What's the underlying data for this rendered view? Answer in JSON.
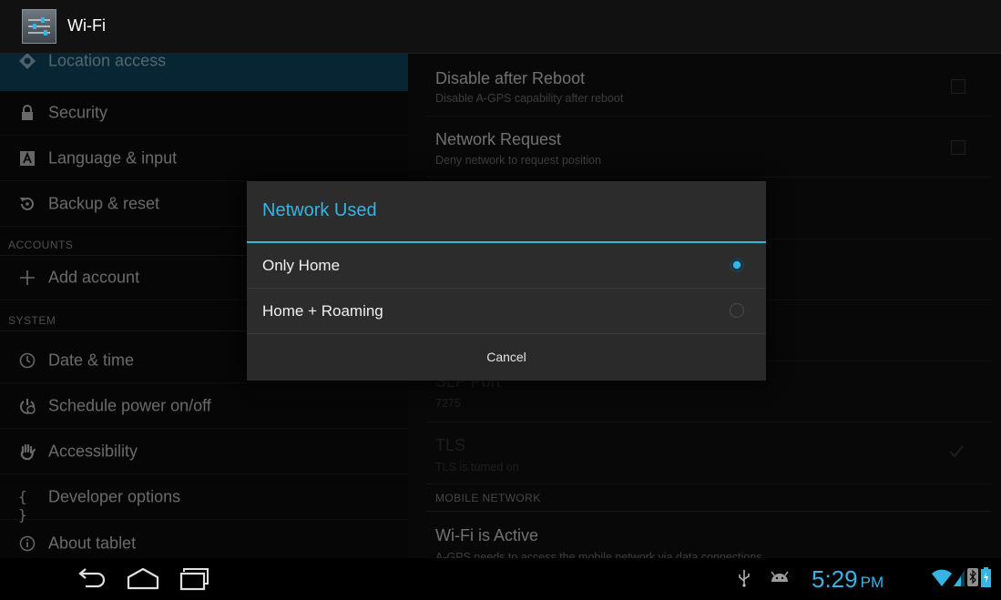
{
  "action_bar": {
    "title": "Wi-Fi",
    "icon": "settings-sliders-icon"
  },
  "left_menu": {
    "items_top": [
      {
        "label": "Location access",
        "icon": "location-icon",
        "active": true
      },
      {
        "label": "Security",
        "icon": "lock-icon"
      },
      {
        "label": "Language & input",
        "icon": "keyboard-icon"
      },
      {
        "label": "Backup & reset",
        "icon": "backup-icon"
      }
    ],
    "accounts_header": "ACCOUNTS",
    "add_account": {
      "label": "Add account",
      "icon": "plus-icon"
    },
    "system_header": "SYSTEM",
    "items_system": [
      {
        "label": "Date & time",
        "icon": "clock-icon"
      },
      {
        "label": "Schedule power on/off",
        "icon": "power-schedule-icon"
      },
      {
        "label": "Accessibility",
        "icon": "hand-icon"
      },
      {
        "label": "Developer options",
        "icon": "braces-icon"
      },
      {
        "label": "About tablet",
        "icon": "info-icon"
      }
    ]
  },
  "right_pane": {
    "prefs": [
      {
        "title": "Disable after Reboot",
        "summary": "Disable A-GPS capability after reboot"
      },
      {
        "title": "Network Request",
        "summary": "Deny network to request position"
      }
    ],
    "slp_port": {
      "title": "SLP Port",
      "summary": "7275"
    },
    "tls": {
      "title": "TLS",
      "summary": "TLS is turned on"
    },
    "mobile_header": "MOBILE NETWORK",
    "wifi_active": {
      "title": "Wi-Fi is Active",
      "summary": "A-GPS needs to access the mobile network via data connections"
    }
  },
  "dialog": {
    "title": "Network Used",
    "options": [
      {
        "label": "Only Home",
        "selected": true
      },
      {
        "label": "Home + Roaming",
        "selected": false
      }
    ],
    "cancel": "Cancel"
  },
  "status_bar": {
    "time": "5:29",
    "ampm": "PM",
    "icons": [
      "usb-icon",
      "android-icon",
      "wifi-icon",
      "signal-icon",
      "bluetooth-icon",
      "battery-icon"
    ]
  },
  "colors": {
    "accent": "#33b5e5",
    "selection": "#0e4a66"
  }
}
